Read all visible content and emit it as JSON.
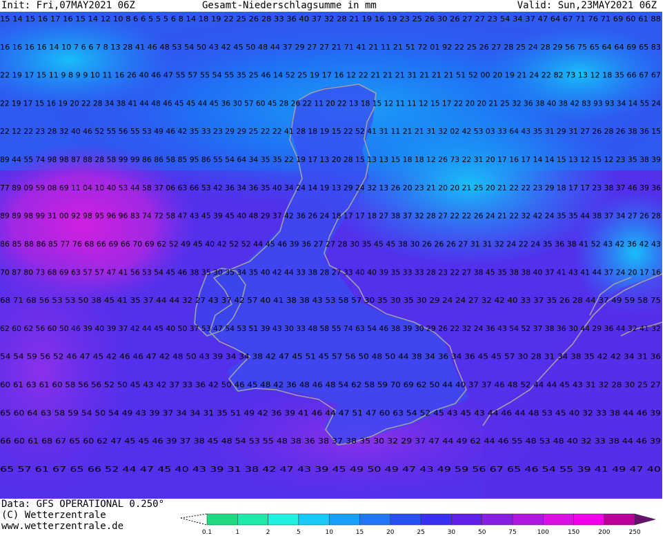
{
  "header": {
    "init": "Init: Fri,07MAY2021 06Z",
    "title": "Gesamt-Niederschlagsumme in mm",
    "valid": "Valid: Sun,23MAY2021 06Z"
  },
  "footer": {
    "data_source": "Data: GFS OPERATIONAL 0.250°",
    "copyright": "(C) Wetterzentrale",
    "url": "www.wetterzentrale.de"
  },
  "legend": {
    "thresholds": [
      "0.1",
      "1",
      "2",
      "5",
      "10",
      "15",
      "20",
      "25",
      "30",
      "50",
      "75",
      "100",
      "150",
      "200",
      "250"
    ],
    "colors": [
      "#20d880",
      "#20e8a8",
      "#20f0e0",
      "#18c8f8",
      "#18a0f8",
      "#2078f8",
      "#2850f0",
      "#3c30f0",
      "#6020e8",
      "#8820e0",
      "#b018e0",
      "#d810e0",
      "#f000e8",
      "#b80098",
      "#8c0080",
      "#681070"
    ]
  },
  "map": {
    "description_colors": {
      "sea_purple": "#6a2ce8",
      "land_blue": "#2a58f0",
      "coast": "#a0a0a0"
    },
    "rows": [
      {
        "text": "15 14 15 16 17 16 15 14 12 10 8 6 6 5 5 5 6 8 14 18 19 22 25 26 28 33 36 40 37 32 28 21 19 16 19 23 25 26 30 26 27 27 23 54 34 37 47 64 67 71 76 71 69 60 61 88"
      },
      {
        "text": "16 16 16 16 14 10 7 6 6 7 8 13 28 41 46 48 53 54 50 43 42 45 50 48 44 37 29 27 27 21 71 41 21 11 21 51 72 01 92 22 25 26 27 28 25 24 28 29 56 75 65 64 64 69 65 83"
      },
      {
        "text": "22 19 17 15 11 9 8 9 9 10 11 16 26 40 46 47 55 57 55 54 55 35 25 46 14 52 25 19 17 16 12 22 21 21 21 31 21 21 21 51 52 00 20 19 21 24 22 82 73 13 12 18 35 66 67 67"
      },
      {
        "text": "22 19 17 15 16 19 20 22 28 34 38 41 44 48 46 45 45 44 45 36 30 57 60 45 28 26 22 11 20 22 13 18 15 12 11 11 12 15 17 22 20 20 21 25 32 36 38 40 38 42 83 93 93 34 14 55 24"
      },
      {
        "text": "22 12 22 23 28 32 40 46 52 55 56 55 53 49 46 42 35 33 23 29 29 25 22 22 41 28 18 19 15 22 52 41 31 11 21 21 31 32 02 42 53 03 33 64 43 35 31 29 31 27 26 28 26 38 36 15"
      },
      {
        "text": "89 44 55 74 98 98 87 88 28 58 99 99 86 86 58 85 95 86 55 54 64 34 35 35 22 19 17 13 20 28 15 13 13 15 18 18 12 26 73 22 31 20 17 16 17 14 14 15 13 12 15 12 23 35 38 39"
      },
      {
        "text": "77 89 09 59 08 69 11 04 10 40 53 44 58 37 06 63 66 53 42 36 34 36 35 40 34 24 14 19 13 29 24 32 13 26 20 23 21 20 20 21 25 20 21 22 22 23 29 18 17 17 23 38 37 46 39 36"
      },
      {
        "text": "89 89 98 99 31 00 92 98 95 96 96 83 74 72 58 47 43 45 39 45 40 48 29 37 42 36 26 24 18 17 17 18 27 38 37 32 28 27 22 22 26 24 21 22 32 42 24 35 35 44 38 37 34 27 26 28"
      },
      {
        "text": "86 85 88 86 85 77 76 68 66 69 66 70 69 62 52 49 45 40 42 52 52 44 45 46 39 36 27 27 28 30 35 45 45 38 30 26 26 26 27 31 31 32 24 22 24 35 36 38 41 52 43 42 36 42 43"
      },
      {
        "text": "70 87 80 73 68 69 63 57 57 47 41 56 53 54 45 46 38 35 30 35 34 35 40 42 44 33 38 28 27 33 40 40 39 35 33 33 28 23 22 27 38 45 35 38 38 40 37 41 43 41 44 37 24 20 17 16"
      },
      {
        "text": "68 71 68 56 53 53 50 38 45 41 35 37 44 44 32 27 43 37 42 57 40 41 38 38 43 53 58 57 30 35 30 35 30 29 24 24 27 32 42 40 33 37 35 26 28 44 37 49 59 58 75"
      },
      {
        "text": "62 60 62 56 60 50 46 39 40 39 37 42 44 45 40 50 37 53 47 54 53 51 39 43 30 33 48 58 55 74 63 54 46 38 39 30 29 26 22 32 24 36 43 54 52 37 38 36 30 44 29 36 44 32 41 32"
      },
      {
        "text": "54 54 59 56 52 46 47 45 42 46 46 47 42 48 50 43 39 34 34 38 42 47 45 51 45 57 56 50 48 50 44 38 34 36 34 36 45 45 57 30 28 31 34 38 35 42 42 34 31 36"
      },
      {
        "text": "60 61 63 61 60 58 56 56 52 50 45 43 42 37 33 36 42 50 46 45 48 42 36 48 46 48 54 62 58 59 70 69 62 50 44 40 37 37 46 48 52 44 44 45 43 31 32 28 30 25 27"
      },
      {
        "text": "65 60 64 63 58 59 54 50 54 49 43 39 37 34 34 31 35 51 49 42 36 39 41 46 44 47 51 47 60 63 54 52 45 43 45 43 44 46 44 48 53 45 40 32 33 38 44 46 39"
      },
      {
        "text": "66 60 61 68 67 65 60 62 47 45 45 46 39 37 38 45 48 54 53 55 48 38 36 38 37 38 35 30 32 29 37 47 44 49 62 44 46 55 48 53 48 40 32 33 38 44 46 39"
      },
      {
        "text": "65 57 61 67 65 66 52 44 47 45 40 43 39 31 38 42 47 43 39 45 49 50 49 47 43 49 59 56 67 65 46 54 55 39 41 49 47 40"
      }
    ]
  }
}
